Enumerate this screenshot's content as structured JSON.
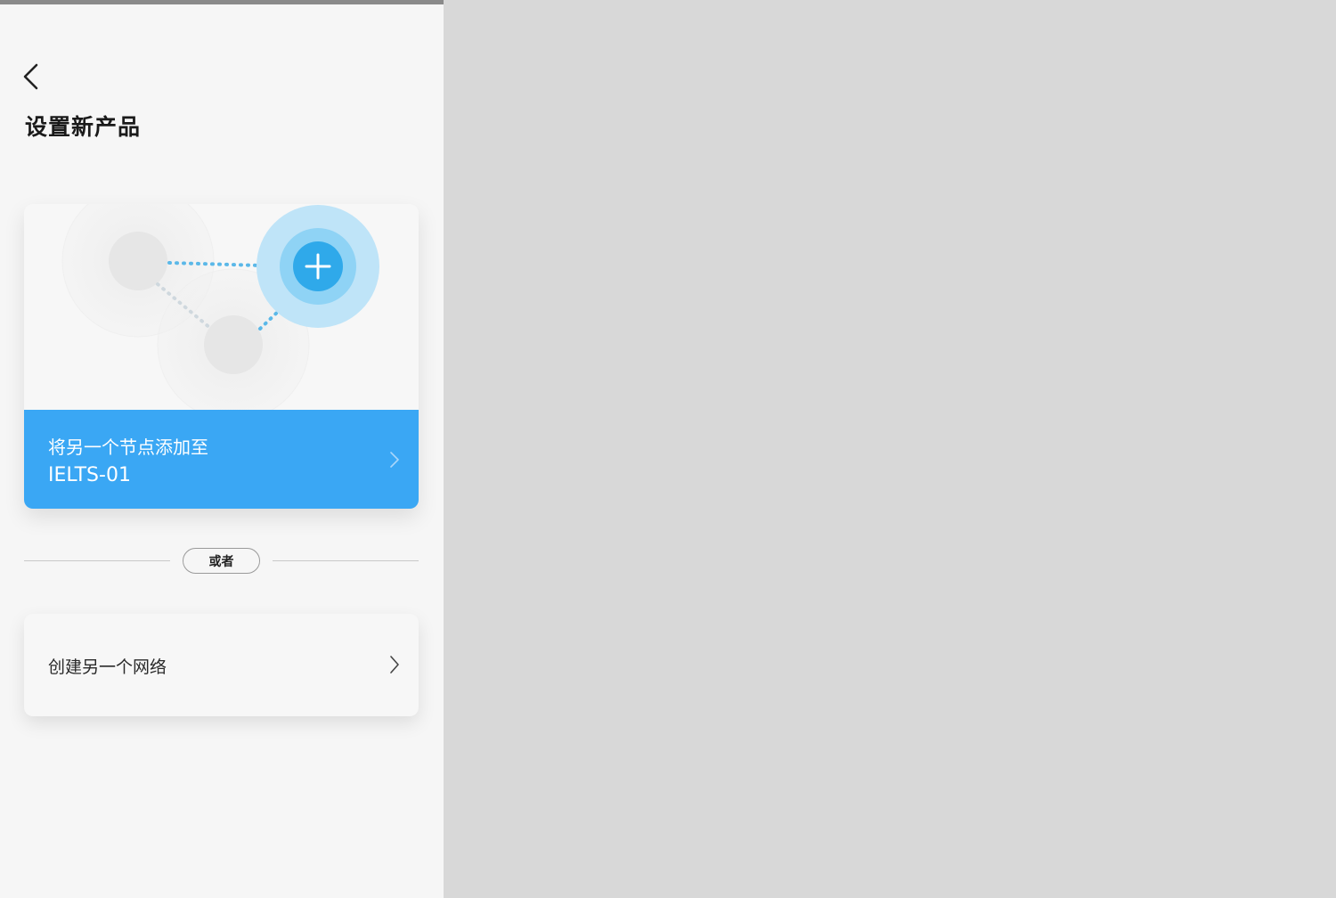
{
  "header": {
    "back_icon": "chevron-left-icon",
    "title": "设置新产品"
  },
  "add_node_card": {
    "illustration_icon": "plus-icon",
    "line1": "将另一个节点添加至",
    "line2": "IELTS-01",
    "chevron_icon": "chevron-right-icon",
    "accent_color": "#3aa7f4"
  },
  "separator": {
    "label": "或者"
  },
  "create_network_card": {
    "label": "创建另一个网络",
    "chevron_icon": "chevron-right-icon"
  }
}
